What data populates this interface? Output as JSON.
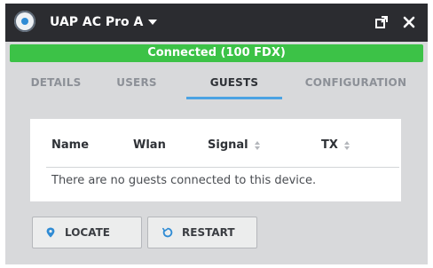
{
  "window": {
    "device_name": "UAP AC Pro A",
    "status": "Connected (100 FDX)"
  },
  "tabs": [
    {
      "label": "DETAILS",
      "active": false
    },
    {
      "label": "USERS",
      "active": false
    },
    {
      "label": "GUESTS",
      "active": true
    },
    {
      "label": "CONFIGURATION",
      "active": false
    }
  ],
  "guests_table": {
    "columns": [
      "Name",
      "Wlan",
      "Signal",
      "TX"
    ],
    "sortable": [
      false,
      false,
      true,
      true
    ],
    "empty_message": "There are no guests connected to this device."
  },
  "actions": {
    "locate_label": "LOCATE",
    "restart_label": "RESTART"
  },
  "icons": {
    "app": "unifi-logo-icon",
    "dropdown": "caret-down-icon",
    "popout": "popout-icon",
    "close": "close-icon",
    "locate": "map-pin-icon",
    "restart": "restart-icon",
    "sort": "sort-icon"
  },
  "colors": {
    "titlebar": "#2b2c30",
    "status_connected": "#3cc247",
    "accent": "#4ba3e3",
    "panel_bg": "#d8d9db"
  }
}
